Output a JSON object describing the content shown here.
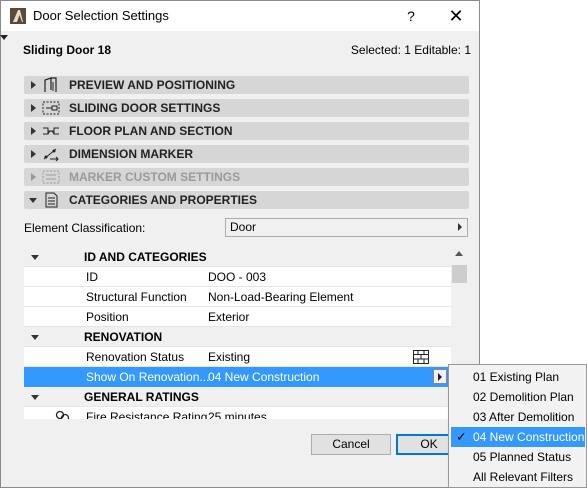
{
  "window": {
    "title": "Door Selection Settings",
    "help": "?",
    "close": "✕"
  },
  "element": {
    "name": "Sliding Door 18",
    "selection": "Selected: 1 Editable: 1"
  },
  "panels": [
    {
      "label": "PREVIEW AND POSITIONING",
      "icon": "door-frame-icon",
      "expanded": false,
      "disabled": false
    },
    {
      "label": "SLIDING DOOR SETTINGS",
      "icon": "sliding-door-icon",
      "expanded": false,
      "disabled": false
    },
    {
      "label": "FLOOR PLAN AND SECTION",
      "icon": "floor-plan-icon",
      "expanded": false,
      "disabled": false
    },
    {
      "label": "DIMENSION MARKER",
      "icon": "dimension-marker-icon",
      "expanded": false,
      "disabled": false
    },
    {
      "label": "MARKER CUSTOM SETTINGS",
      "icon": "marker-settings-icon",
      "expanded": false,
      "disabled": true
    },
    {
      "label": "CATEGORIES AND PROPERTIES",
      "icon": "document-icon",
      "expanded": true,
      "disabled": false
    }
  ],
  "classification": {
    "label": "Element Classification:",
    "value": "Door"
  },
  "properties": {
    "groups": {
      "id": "ID AND CATEGORIES",
      "renovation": "RENOVATION",
      "general": "GENERAL RATINGS"
    },
    "rows": {
      "id": {
        "name": "ID",
        "value": "DOO - 003"
      },
      "structural": {
        "name": "Structural Function",
        "value": "Non-Load-Bearing Element"
      },
      "position": {
        "name": "Position",
        "value": "Exterior"
      },
      "renovation_status": {
        "name": "Renovation Status",
        "value": "Existing"
      },
      "show_on": {
        "name": "Show On Renovation...",
        "value": "04 New Construction"
      },
      "fire": {
        "name": "Fire Resistance Rating",
        "value": "25 minutes"
      }
    }
  },
  "buttons": {
    "cancel": "Cancel",
    "ok": "OK"
  },
  "popup": {
    "items": [
      "01 Existing Plan",
      "02 Demolition Plan",
      "03 After Demolition",
      "04 New Construction",
      "05 Planned Status",
      "All Relevant Filters"
    ],
    "selected_index": 3,
    "check": "✓"
  },
  "colors": {
    "selection": "#3399ff",
    "panel": "#d6d6d6"
  }
}
